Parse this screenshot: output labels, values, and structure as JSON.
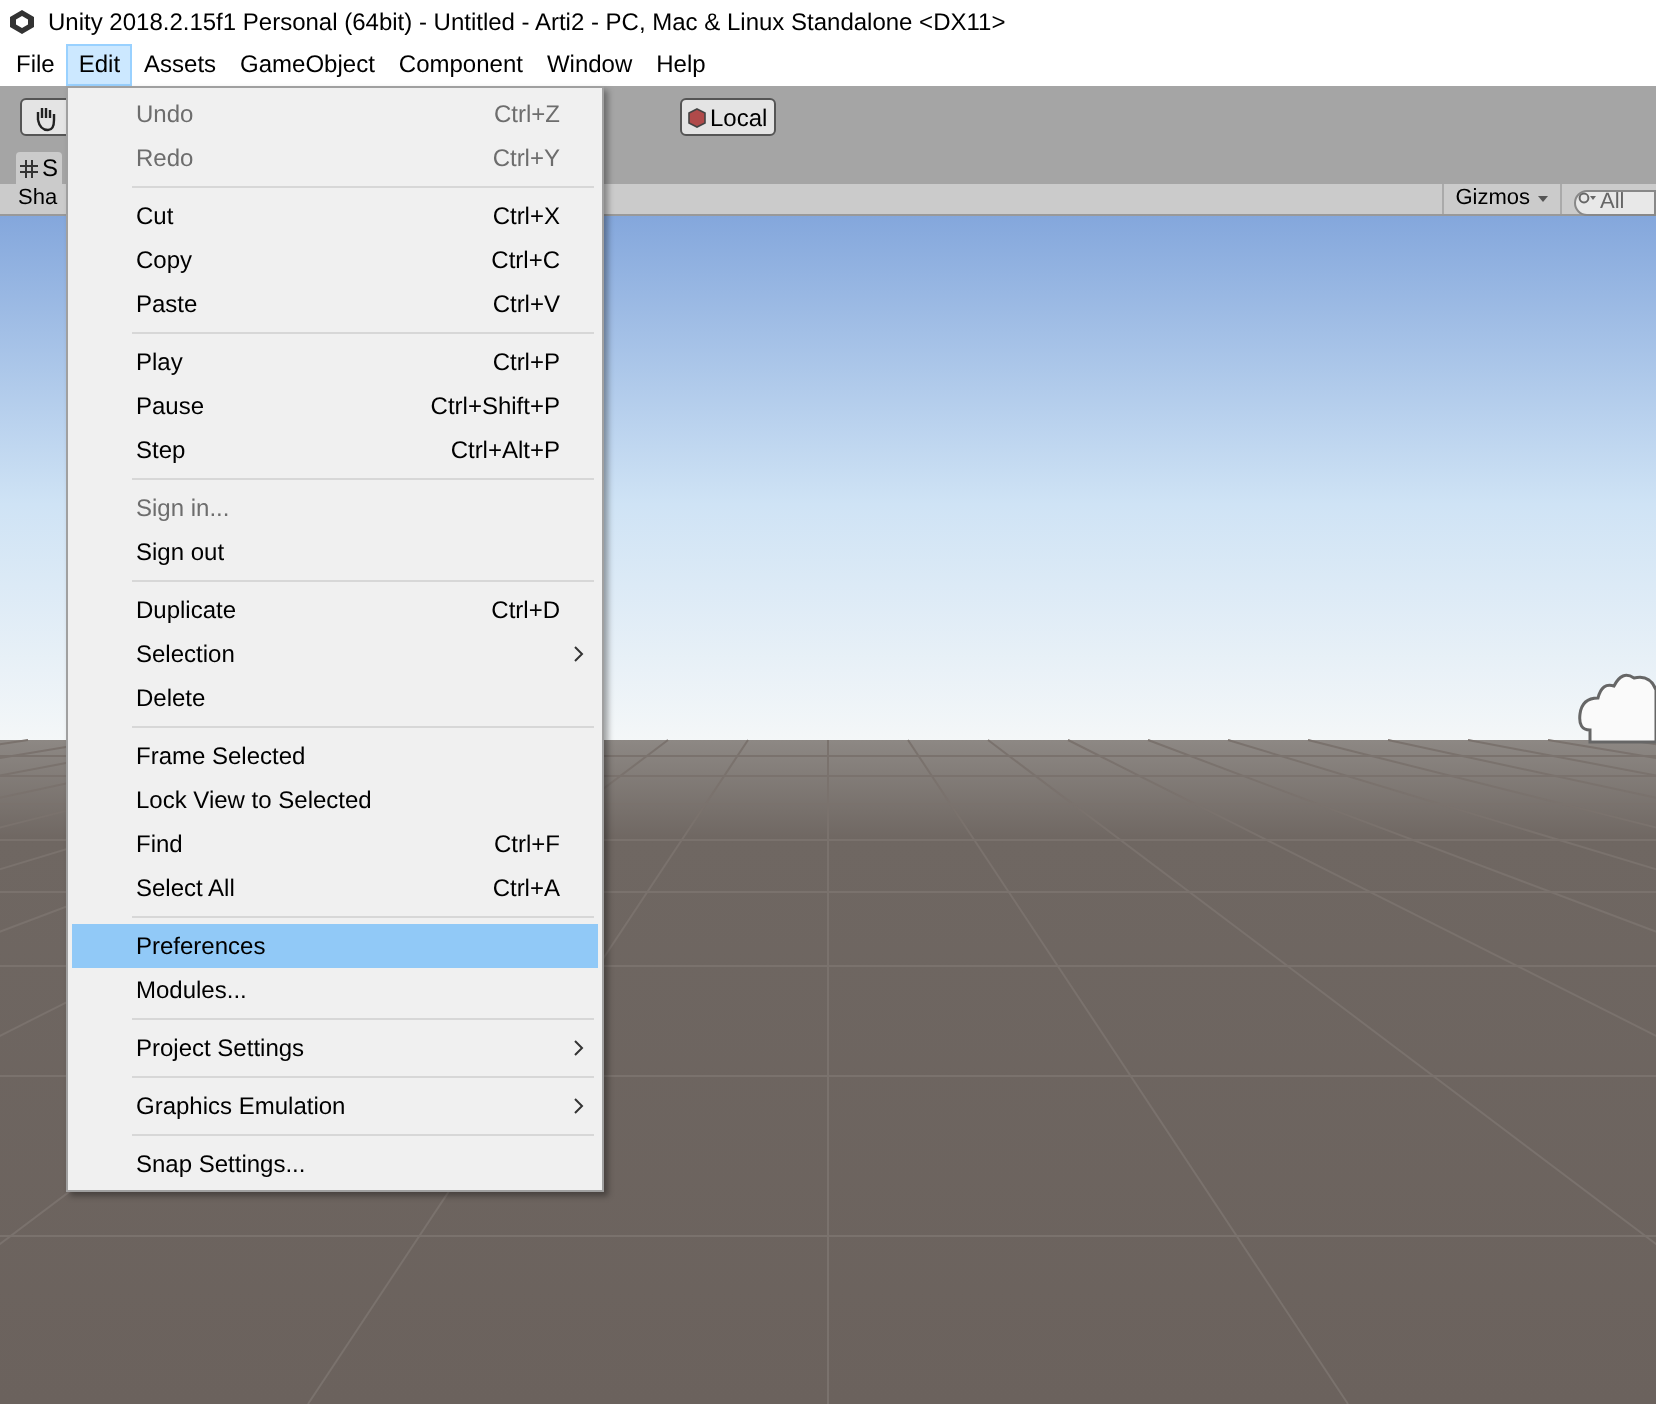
{
  "window": {
    "title": "Unity 2018.2.15f1 Personal (64bit) - Untitled - Arti2 - PC, Mac & Linux Standalone <DX11>"
  },
  "menu_bar": [
    {
      "label": "File",
      "selected": false
    },
    {
      "label": "Edit",
      "selected": true
    },
    {
      "label": "Assets",
      "selected": false
    },
    {
      "label": "GameObject",
      "selected": false
    },
    {
      "label": "Component",
      "selected": false
    },
    {
      "label": "Window",
      "selected": false
    },
    {
      "label": "Help",
      "selected": false
    }
  ],
  "toolbar": {
    "local_button": "Local"
  },
  "scene_tab": {
    "label": "S"
  },
  "scene_toolbar": {
    "shading": "Sha",
    "gizmos": "Gizmos",
    "search": {
      "placeholder": "All"
    }
  },
  "edit_menu": [
    {
      "kind": "item",
      "label": "Undo",
      "shortcut": "Ctrl+Z",
      "disabled": true,
      "selected": false,
      "submenu": false
    },
    {
      "kind": "item",
      "label": "Redo",
      "shortcut": "Ctrl+Y",
      "disabled": true,
      "selected": false,
      "submenu": false
    },
    {
      "kind": "separator"
    },
    {
      "kind": "item",
      "label": "Cut",
      "shortcut": "Ctrl+X",
      "disabled": false,
      "selected": false,
      "submenu": false
    },
    {
      "kind": "item",
      "label": "Copy",
      "shortcut": "Ctrl+C",
      "disabled": false,
      "selected": false,
      "submenu": false
    },
    {
      "kind": "item",
      "label": "Paste",
      "shortcut": "Ctrl+V",
      "disabled": false,
      "selected": false,
      "submenu": false
    },
    {
      "kind": "separator"
    },
    {
      "kind": "item",
      "label": "Play",
      "shortcut": "Ctrl+P",
      "disabled": false,
      "selected": false,
      "submenu": false
    },
    {
      "kind": "item",
      "label": "Pause",
      "shortcut": "Ctrl+Shift+P",
      "disabled": false,
      "selected": false,
      "submenu": false
    },
    {
      "kind": "item",
      "label": "Step",
      "shortcut": "Ctrl+Alt+P",
      "disabled": false,
      "selected": false,
      "submenu": false
    },
    {
      "kind": "separator"
    },
    {
      "kind": "item",
      "label": "Sign in...",
      "disabled": true,
      "selected": false,
      "submenu": false
    },
    {
      "kind": "item",
      "label": "Sign out",
      "disabled": false,
      "selected": false,
      "submenu": false
    },
    {
      "kind": "separator"
    },
    {
      "kind": "item",
      "label": "Duplicate",
      "shortcut": "Ctrl+D",
      "disabled": false,
      "selected": false,
      "submenu": false
    },
    {
      "kind": "item",
      "label": "Selection",
      "disabled": false,
      "selected": false,
      "submenu": true
    },
    {
      "kind": "item",
      "label": "Delete",
      "disabled": false,
      "selected": false,
      "submenu": false
    },
    {
      "kind": "separator"
    },
    {
      "kind": "item",
      "label": "Frame Selected",
      "disabled": false,
      "selected": false,
      "submenu": false
    },
    {
      "kind": "item",
      "label": "Lock View to Selected",
      "disabled": false,
      "selected": false,
      "submenu": false
    },
    {
      "kind": "item",
      "label": "Find",
      "shortcut": "Ctrl+F",
      "disabled": false,
      "selected": false,
      "submenu": false
    },
    {
      "kind": "item",
      "label": "Select All",
      "shortcut": "Ctrl+A",
      "disabled": false,
      "selected": false,
      "submenu": false
    },
    {
      "kind": "separator"
    },
    {
      "kind": "item",
      "label": "Preferences",
      "disabled": false,
      "selected": true,
      "submenu": false
    },
    {
      "kind": "item",
      "label": "Modules...",
      "disabled": false,
      "selected": false,
      "submenu": false
    },
    {
      "kind": "separator"
    },
    {
      "kind": "item",
      "label": "Project Settings",
      "disabled": false,
      "selected": false,
      "submenu": true
    },
    {
      "kind": "separator"
    },
    {
      "kind": "item",
      "label": "Graphics Emulation",
      "disabled": false,
      "selected": false,
      "submenu": true
    },
    {
      "kind": "separator"
    },
    {
      "kind": "item",
      "label": "Snap Settings...",
      "disabled": false,
      "selected": false,
      "submenu": false
    }
  ]
}
